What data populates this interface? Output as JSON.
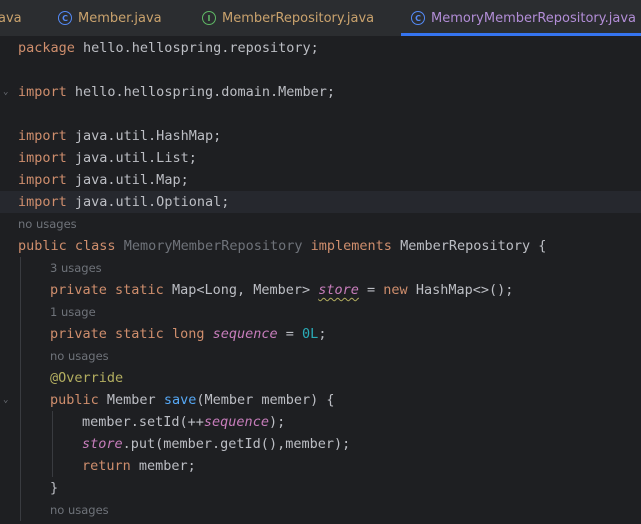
{
  "tabs": [
    {
      "label": "ava",
      "icon": "none",
      "active": false
    },
    {
      "label": "Member.java",
      "icon": "class-icon",
      "active": false
    },
    {
      "label": "MemberRepository.java",
      "icon": "interface-icon",
      "active": false
    },
    {
      "label": "MemoryMemberRepository.java",
      "icon": "class-icon",
      "active": true
    }
  ],
  "icon_glyphs": {
    "class": "C",
    "interface": "I"
  },
  "colors": {
    "tab_active_underline": "#3574f0",
    "keyword": "#cf8e6d",
    "function": "#56a8f5",
    "field": "#c77dbb",
    "number": "#2aacb8",
    "annotation": "#b3ae60"
  },
  "code": {
    "package": {
      "kw": "package",
      "name": " hello.hellospring.repository;"
    },
    "imports": [
      {
        "kw": "import",
        "name": " hello.hellospring.domain.Member;"
      },
      {
        "kw": "import",
        "name": " java.util.HashMap;"
      },
      {
        "kw": "import",
        "name": " java.util.List;"
      },
      {
        "kw": "import",
        "name": " java.util.Map;"
      },
      {
        "kw": "import",
        "name": " java.util.Optional;"
      }
    ],
    "class_usage_hint": "no usages",
    "class_decl": {
      "kw1": "public",
      "kw2": "class",
      "name": "MemoryMemberRepository",
      "kw3": "implements",
      "iface": "MemberRepository {"
    },
    "store_hint": "3 usages",
    "store_decl": {
      "kw1": "private",
      "kw2": "static",
      "type": " Map<Long, Member> ",
      "field": "store",
      "eq": " = ",
      "kw3": "new",
      "rest": " HashMap<>();"
    },
    "seq_hint": "1 usage",
    "seq_decl": {
      "kw1": "private",
      "kw2": "static",
      "kw3": "long",
      "field": "sequence",
      "eq": " = ",
      "num": "0L",
      "end": ";"
    },
    "save_hint": "no usages",
    "override": "@Override",
    "save_decl": {
      "kw": "public",
      "type": " Member ",
      "method": "save",
      "params": "(Member member) {"
    },
    "body": {
      "line1": {
        "prefix": "member.setId(++",
        "field": "sequence",
        "suffix": ");"
      },
      "line2": {
        "field": "store",
        "rest": ".put(member.getId(),member);"
      },
      "line3": {
        "kw": "return",
        "rest": " member;"
      }
    },
    "close_brace": "}",
    "next_hint": "no usages"
  }
}
